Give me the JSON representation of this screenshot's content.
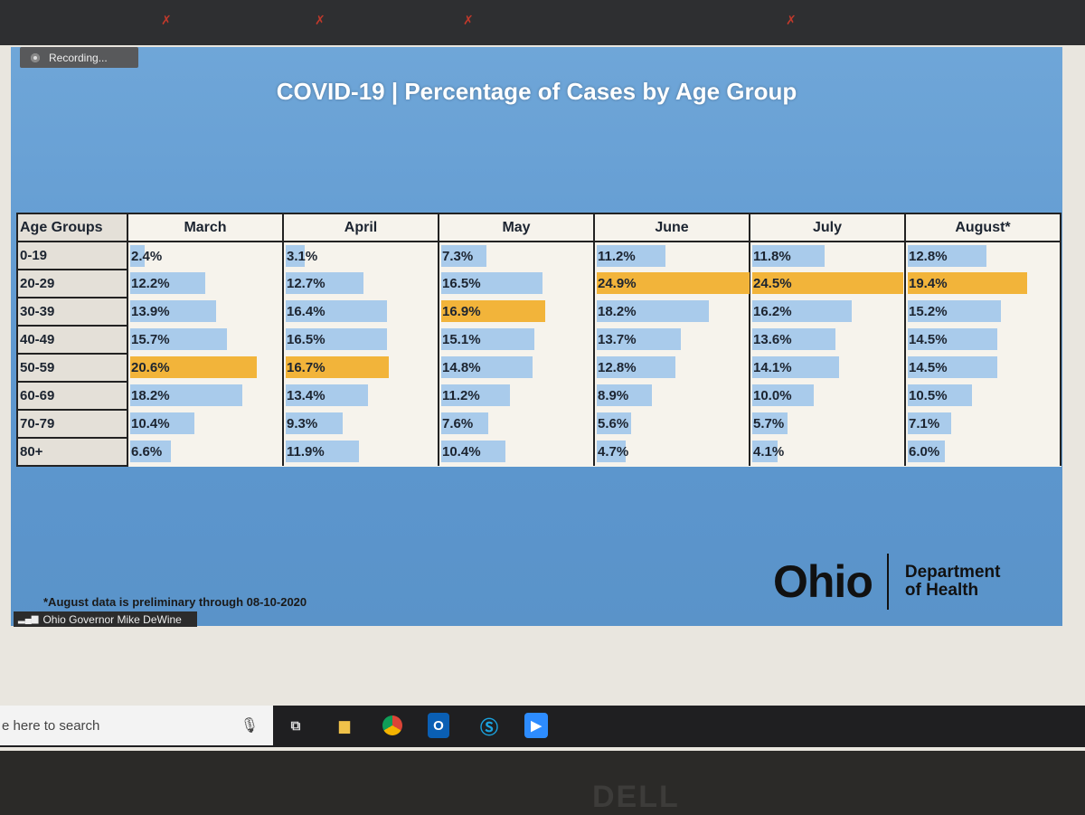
{
  "zoom": {
    "recording_label": "Recording...",
    "speaker_name": "Ohio Governor Mike DeWine"
  },
  "slide": {
    "title": "COVID-19 | Percentage of Cases by Age Group",
    "footnote": "*August data is preliminary through 08-10-2020",
    "logo": {
      "ohio": "Ohio",
      "dept_line1": "Department",
      "dept_line2": "of Health"
    }
  },
  "chart_data": {
    "type": "table",
    "title": "COVID-19 | Percentage of Cases by Age Group",
    "row_header": "Age Groups",
    "categories": [
      "0-19",
      "20-29",
      "30-39",
      "40-49",
      "50-59",
      "60-69",
      "70-79",
      "80+"
    ],
    "series": [
      {
        "name": "March",
        "values": [
          2.4,
          12.2,
          13.9,
          15.7,
          20.6,
          18.2,
          10.4,
          6.6
        ],
        "labels": [
          "2.4%",
          "12.2%",
          "13.9%",
          "15.7%",
          "20.6%",
          "18.2%",
          "10.4%",
          "6.6%"
        ]
      },
      {
        "name": "April",
        "values": [
          3.1,
          12.7,
          16.4,
          16.5,
          16.7,
          13.4,
          9.3,
          11.9
        ],
        "labels": [
          "3.1%",
          "12.7%",
          "16.4%",
          "16.5%",
          "16.7%",
          "13.4%",
          "9.3%",
          "11.9%"
        ]
      },
      {
        "name": "May",
        "values": [
          7.3,
          16.5,
          16.9,
          15.1,
          14.8,
          11.2,
          7.6,
          10.4
        ],
        "labels": [
          "7.3%",
          "16.5%",
          "16.9%",
          "15.1%",
          "14.8%",
          "11.2%",
          "7.6%",
          "10.4%"
        ]
      },
      {
        "name": "June",
        "values": [
          11.2,
          24.9,
          18.2,
          13.7,
          12.8,
          8.9,
          5.6,
          4.7
        ],
        "labels": [
          "11.2%",
          "24.9%",
          "18.2%",
          "13.7%",
          "12.8%",
          "8.9%",
          "5.6%",
          "4.7%"
        ]
      },
      {
        "name": "July",
        "values": [
          11.8,
          24.5,
          16.2,
          13.6,
          14.1,
          10.0,
          5.7,
          4.1
        ],
        "labels": [
          "11.8%",
          "24.5%",
          "16.2%",
          "13.6%",
          "14.1%",
          "10.0%",
          "5.7%",
          "4.1%"
        ]
      },
      {
        "name": "August*",
        "values": [
          12.8,
          19.4,
          15.2,
          14.5,
          14.5,
          10.5,
          7.1,
          6.0
        ],
        "labels": [
          "12.8%",
          "19.4%",
          "15.2%",
          "14.5%",
          "14.5%",
          "10.5%",
          "7.1%",
          "6.0%"
        ]
      }
    ],
    "colors": {
      "bar": "#a9cbeb",
      "highlight_max": "#f2b43a"
    }
  },
  "taskbar": {
    "search_placeholder": "e here to search",
    "icons": [
      "microphone-icon",
      "task-view-icon",
      "file-explorer-icon",
      "chrome-icon",
      "outlook-icon",
      "skype-icon",
      "zoom-icon"
    ]
  },
  "bezel": {
    "brand": "DELL"
  }
}
